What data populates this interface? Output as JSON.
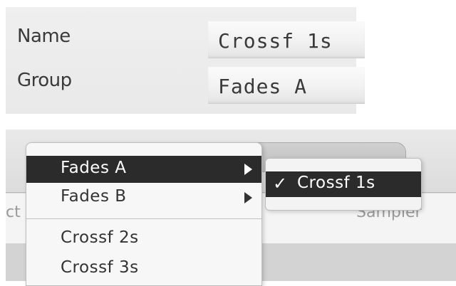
{
  "fields": {
    "name_label": "Name",
    "name_value": "Crossf 1s",
    "group_label": "Group",
    "group_value": "Fades A"
  },
  "header": {
    "left_partial_text": "ct",
    "right_text": "Sampler"
  },
  "menu": {
    "items": [
      {
        "label": "Fades A",
        "has_submenu": true,
        "highlighted": true
      },
      {
        "label": "Fades B",
        "has_submenu": true,
        "highlighted": false
      },
      {
        "label": "Crossf 2s",
        "has_submenu": false,
        "highlighted": false
      },
      {
        "label": "Crossf 3s",
        "has_submenu": false,
        "highlighted": false
      }
    ]
  },
  "submenu": {
    "items": [
      {
        "label": "Crossf 1s",
        "checked": true,
        "check_glyph": "✓"
      }
    ]
  },
  "colors": {
    "highlight": "#2b2b2b",
    "menu_bg": "#f7f7f7",
    "text": "#333333"
  }
}
